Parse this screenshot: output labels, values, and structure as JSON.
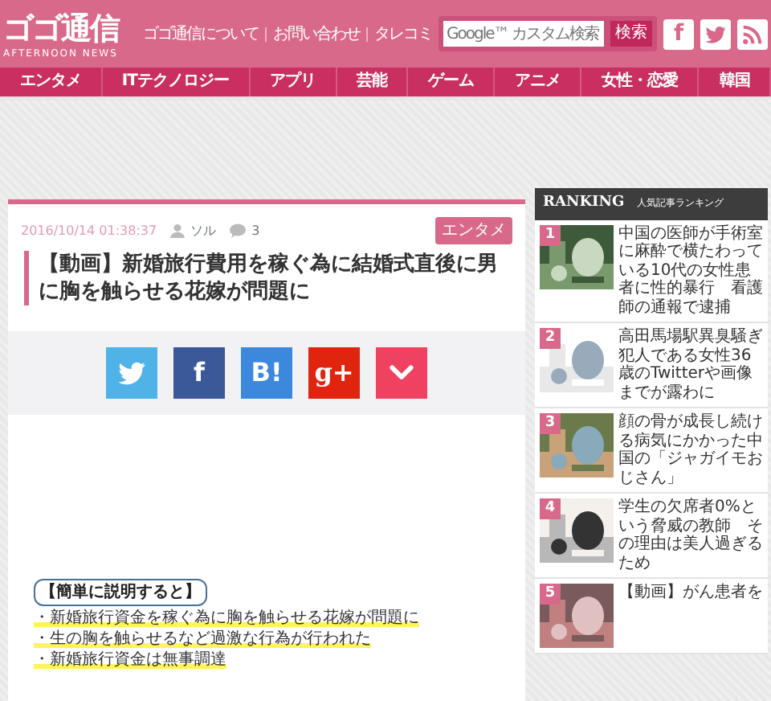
{
  "header": {
    "logo": "ゴゴ通信",
    "tagline": "AFTERNOON NEWS",
    "links": [
      "ゴゴ通信について",
      "お問い合わせ",
      "タレコミ"
    ],
    "search": {
      "placeholder": "Google™ カスタム検索",
      "button": "検索"
    },
    "social": [
      {
        "kind": "facebook",
        "label": "f"
      },
      {
        "kind": "twitter"
      },
      {
        "kind": "rss"
      }
    ]
  },
  "nav": [
    "エンタメ",
    "ITテクノロジー",
    "アプリ",
    "芸能",
    "ゲーム",
    "アニメ",
    "女性・恋愛",
    "韓国"
  ],
  "article": {
    "date": "2016/10/14 01:38:37",
    "author": "ソル",
    "comments": "3",
    "category": "エンタメ",
    "title": "【動画】新婚旅行費用を稼ぐ為に結婚式直後に男に胸を触らせる花嫁が問題に",
    "share": [
      {
        "kind": "twitter"
      },
      {
        "kind": "facebook",
        "label": "f"
      },
      {
        "kind": "hatena",
        "label": "B!"
      },
      {
        "kind": "googleplus",
        "label": "g+"
      },
      {
        "kind": "pocket"
      }
    ],
    "summary": {
      "heading": "【簡単に説明すると】",
      "points": [
        "・新婚旅行資金を稼ぐ為に胸を触らせる花嫁が問題に",
        "・生の胸を触らせるなど過激な行為が行われた",
        "・新婚旅行資金は無事調達"
      ]
    }
  },
  "sidebar": {
    "heading": "RANKING",
    "subheading": "人気記事ランキング",
    "items": [
      {
        "rank": "1",
        "title": "中国の医師が手術室に麻酔で横たわっている10代の女性患者に性的暴行　看護師の通報で逮捕"
      },
      {
        "rank": "2",
        "title": "高田馬場駅異臭騒ぎ犯人である女性36歳のTwitterや画像までが露わに"
      },
      {
        "rank": "3",
        "title": "顔の骨が成長し続ける病気にかかった中国の「ジャガイモおじさん」"
      },
      {
        "rank": "4",
        "title": "学生の欠席者0%という脅威の教師　その理由は美人過ぎるため"
      },
      {
        "rank": "5",
        "title": "【動画】がん患者を"
      }
    ]
  }
}
